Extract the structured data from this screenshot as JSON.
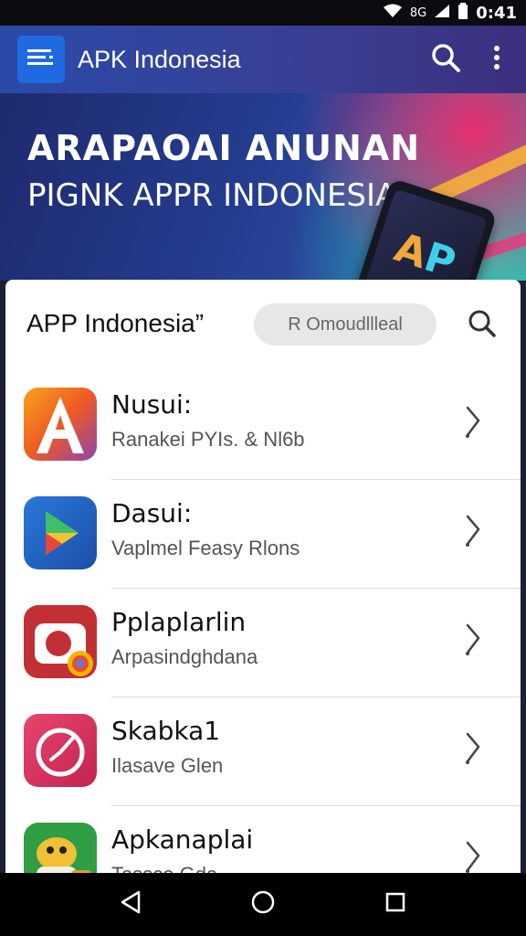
{
  "status_bar": {
    "network": "8G",
    "time": "0:41"
  },
  "app_bar": {
    "title": "APK Indonesia"
  },
  "banner": {
    "headline": "ARAPAOAI ANUNAN",
    "subheadline": "PIGNK APPR INDONESIA"
  },
  "section": {
    "title": "APP Indonesia”",
    "chip_label": "R Omoudllleal"
  },
  "apps": [
    {
      "name": "Nusui:",
      "subtitle": "Ranakei PYIs. & Nl6b",
      "icon": "letter-a-app-icon"
    },
    {
      "name": "Dasui:",
      "subtitle": "Vaplmel Feasy Rlons",
      "icon": "play-store-icon"
    },
    {
      "name": "Pplaplarlin",
      "subtitle": "Arpasindghdana",
      "icon": "camera-app-icon"
    },
    {
      "name": "Skabka1",
      "subtitle": "Ilasave Glen",
      "icon": "clock-app-icon"
    },
    {
      "name": "Apkanaplai",
      "subtitle": "Tassce Gda",
      "icon": "android-mascot-icon"
    }
  ],
  "colors": {
    "app_bar": "#2a4aa8",
    "accent": "#1f6ae0",
    "chip": "#e7e7e7"
  }
}
